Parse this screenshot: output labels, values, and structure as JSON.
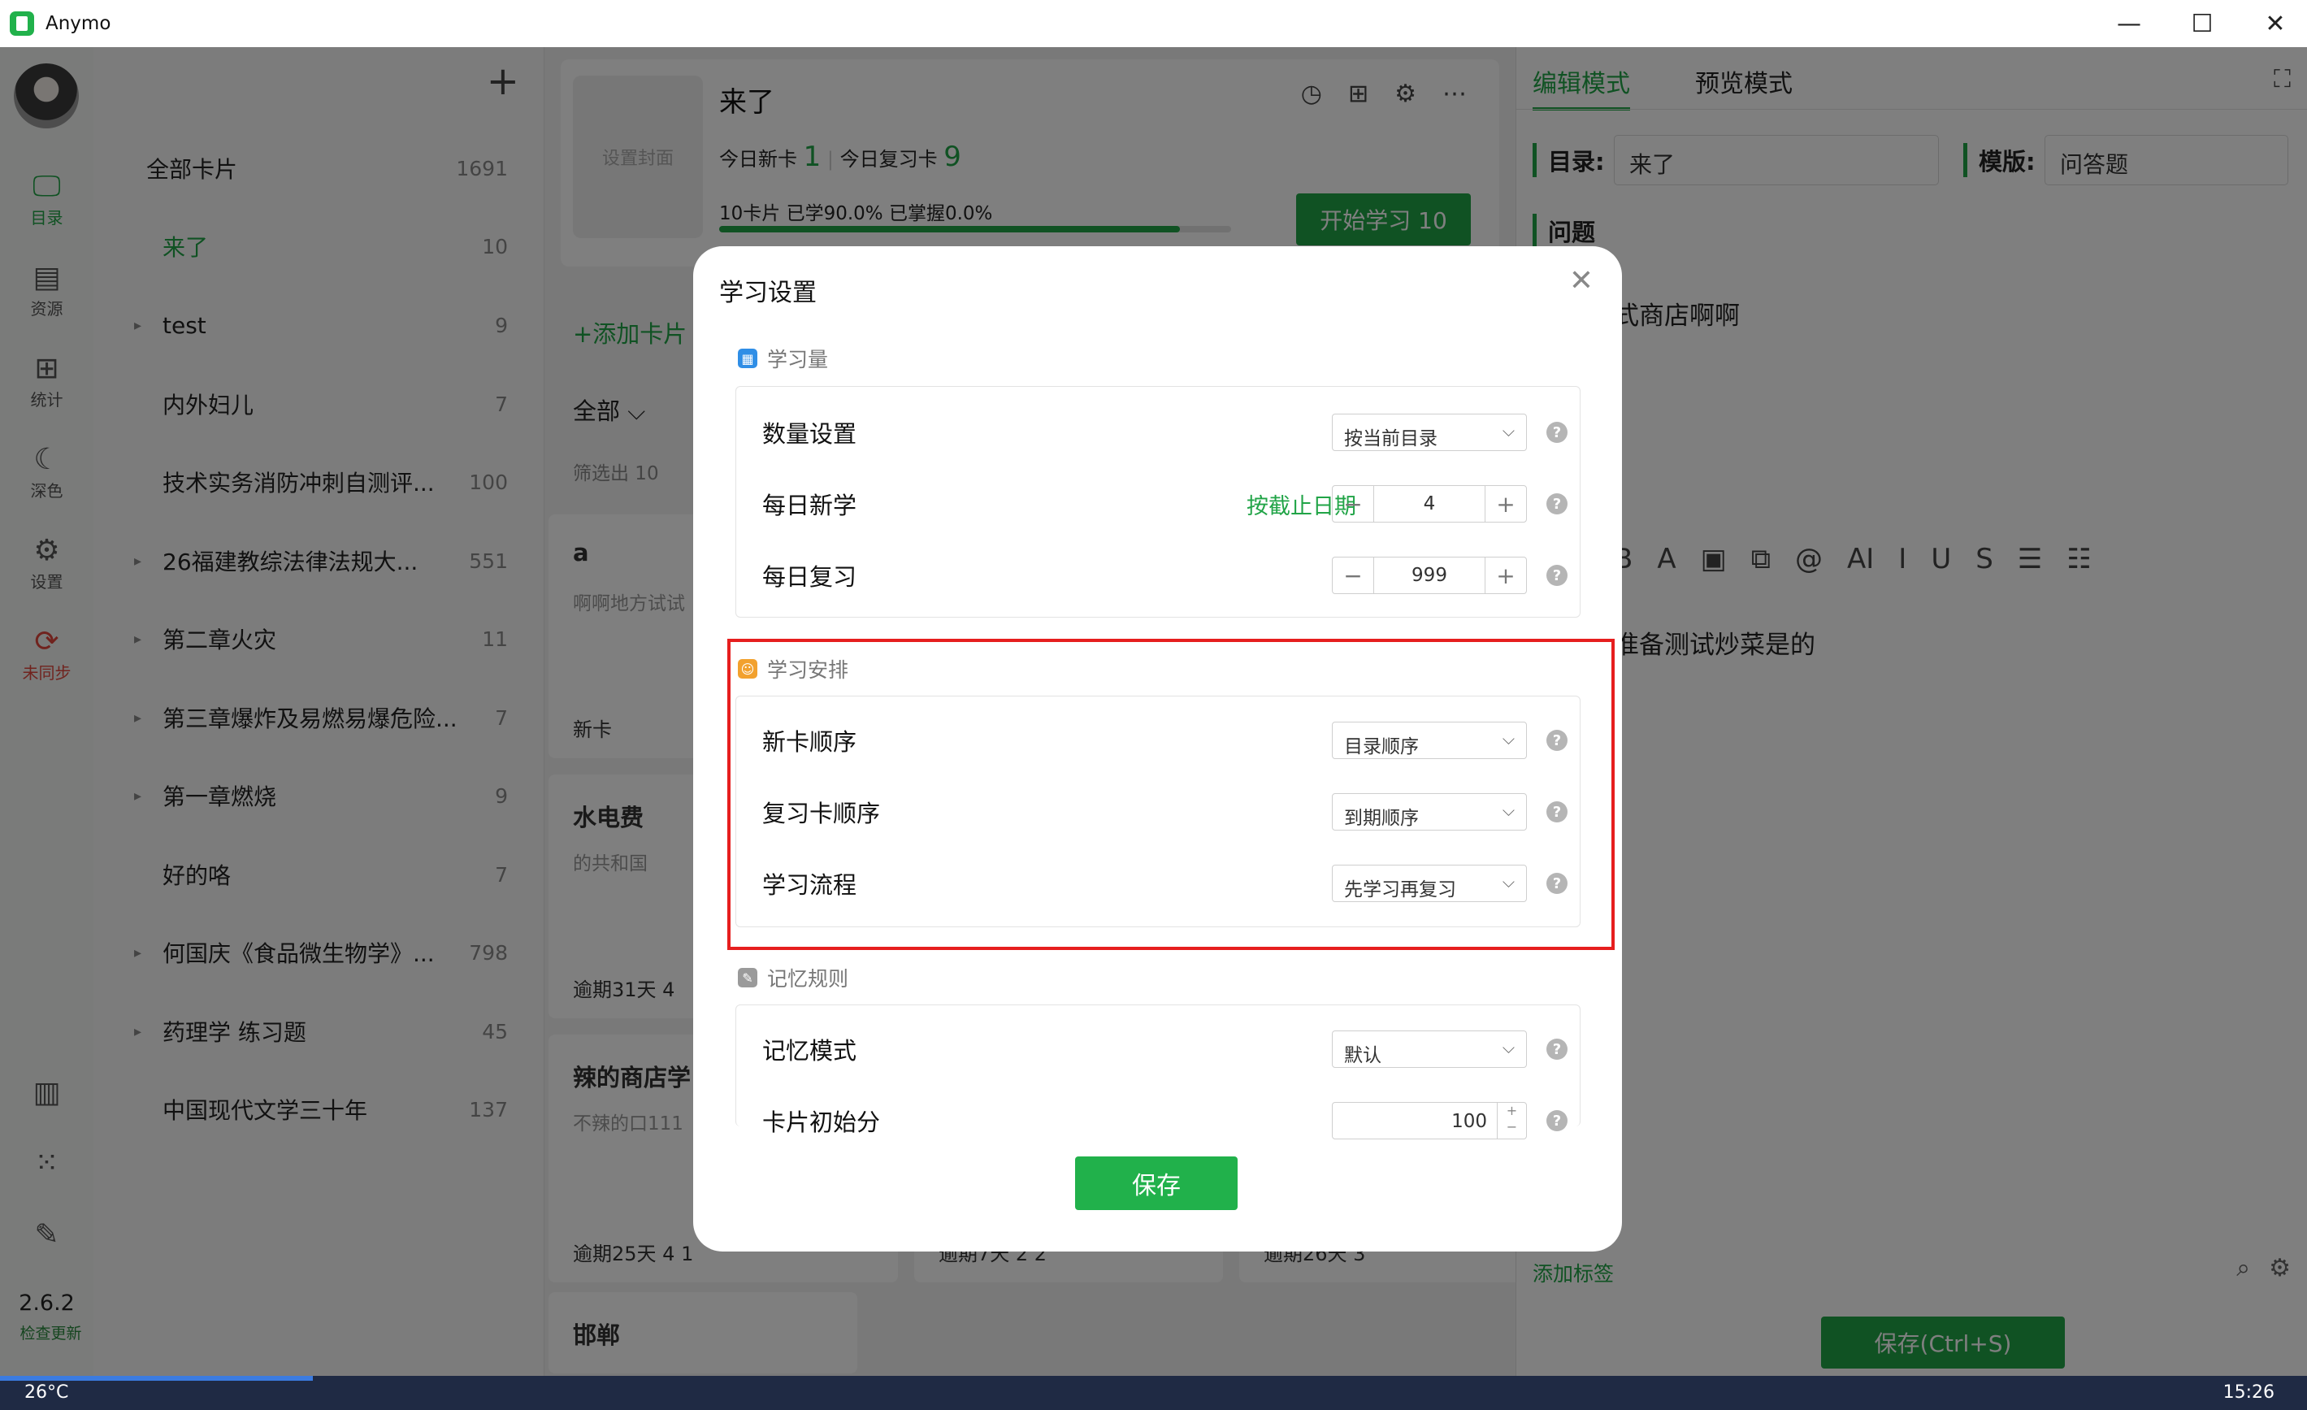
{
  "window": {
    "title": "Anymo"
  },
  "nav": {
    "items": [
      {
        "label": "目录",
        "icon": "monitor-icon"
      },
      {
        "label": "资源",
        "icon": "card-icon"
      },
      {
        "label": "统计",
        "icon": "presentation-icon"
      },
      {
        "label": "深色",
        "icon": "moon-icon"
      },
      {
        "label": "设置",
        "icon": "gear-icon"
      },
      {
        "label": "未同步",
        "icon": "sync-icon"
      }
    ],
    "version": "2.6.2",
    "update_label": "检查更新"
  },
  "sidebar": {
    "add_label": "+",
    "tree": [
      {
        "name": "全部卡片",
        "count": "1691"
      },
      {
        "name": "来了",
        "count": "10"
      },
      {
        "name": "test",
        "count": "9"
      },
      {
        "name": "内外妇儿",
        "count": "7"
      },
      {
        "name": "技术实务消防冲刺自测评...",
        "count": "100"
      },
      {
        "name": "26福建教综法律法规大...",
        "count": "551"
      },
      {
        "name": "第二章火灾",
        "count": "11"
      },
      {
        "name": "第三章爆炸及易燃易爆危险...",
        "count": "7"
      },
      {
        "name": "第一章燃烧",
        "count": "9"
      },
      {
        "name": "好的咯",
        "count": "7"
      },
      {
        "name": "何国庆《食品微生物学》...",
        "count": "798"
      },
      {
        "name": "药理学 练习题",
        "count": "45"
      },
      {
        "name": "中国现代文学三十年",
        "count": "137"
      }
    ]
  },
  "deck": {
    "cover_label": "设置封面",
    "title": "来了",
    "today_new_label": "今日新卡",
    "today_new": "1",
    "today_review_label": "今日复习卡",
    "today_review": "9",
    "progress_text": "10卡片   已学90.0%   已掌握0.0%",
    "learned_fraction": 0.9,
    "start_label": "开始学习 10",
    "add_card_label": "+添加卡片",
    "filter_all": "全部",
    "filter_count": "筛选出 10",
    "cards": [
      {
        "title": "a",
        "desc": "啊啊地方试试",
        "footer": "新卡"
      },
      {
        "title": "水电费",
        "desc": "的共和国",
        "footer": "逾期31天 4"
      },
      {
        "title": "辣的商店学",
        "desc": "不辣的口111",
        "footer": "逾期25天 4  1"
      },
      {
        "title": "邯郸",
        "desc": "",
        "footer": ""
      }
    ],
    "card_footers_extra": [
      "逾期7天 2  2",
      "逾期26天 3"
    ]
  },
  "editor": {
    "tab_edit": "编辑模式",
    "tab_preview": "预览模式",
    "dir_label": "目录:",
    "dir_value": "来了",
    "template_label": "模版:",
    "template_value": "问答题",
    "question_label": "问题",
    "question_text": "式商店啊啊",
    "answer_text": "准备测试炒菜是的",
    "add_tag": "添加标签",
    "save_label": "保存(Ctrl+S)"
  },
  "modal": {
    "title": "学习设置",
    "sections": {
      "amount": "学习量",
      "schedule": "学习安排",
      "memory": "记忆规则"
    },
    "rows": {
      "quantity_label": "数量设置",
      "quantity_value": "按当前目录",
      "daily_new_label": "每日新学",
      "daily_new_deadline": "按截止日期",
      "daily_new_value": "4",
      "daily_review_label": "每日复习",
      "daily_review_value": "999",
      "new_order_label": "新卡顺序",
      "new_order_value": "目录顺序",
      "review_order_label": "复习卡顺序",
      "review_order_value": "到期顺序",
      "flow_label": "学习流程",
      "flow_value": "先学习再复习",
      "memory_mode_label": "记忆模式",
      "memory_mode_value": "默认",
      "initial_score_label": "卡片初始分",
      "initial_score_value": "100"
    },
    "save_label": "保存",
    "colors": {
      "accent": "#21a447",
      "highlight": "#e61e1e"
    }
  },
  "taskbar": {
    "weather": "26°C",
    "time": "15:26"
  }
}
